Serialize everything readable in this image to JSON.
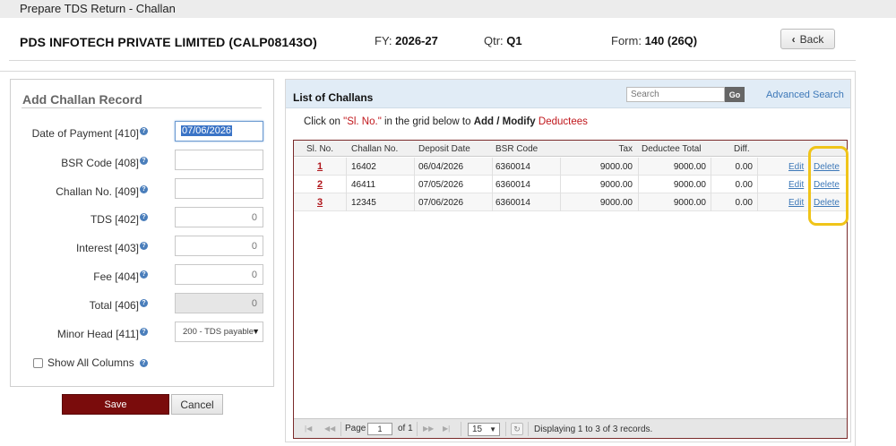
{
  "window": {
    "title": "Prepare TDS Return - Challan"
  },
  "header": {
    "company": "PDS INFOTECH PRIVATE LIMITED (CALP08143O)",
    "fy_label": "FY:",
    "fy_value": "2026-27",
    "qtr_label": "Qtr:",
    "qtr_value": "Q1",
    "form_label": "Form:",
    "form_value": "140 (26Q)",
    "back_label": "Back"
  },
  "left_panel": {
    "title": "Add Challan Record",
    "fields": [
      {
        "label": "Date of Payment [410]",
        "value": "07/06/2026"
      },
      {
        "label": "BSR Code [408]",
        "value": ""
      },
      {
        "label": "Challan No. [409]",
        "value": ""
      },
      {
        "label": "TDS [402]",
        "value": "0"
      },
      {
        "label": "Interest [403]",
        "value": "0"
      },
      {
        "label": "Fee [404]",
        "value": "0"
      },
      {
        "label": "Total [406]",
        "value": "0"
      },
      {
        "label": "Minor Head [411]",
        "value": "200 - TDS payable"
      }
    ],
    "show_all_columns": "Show All Columns",
    "save_label": "Save",
    "cancel_label": "Cancel"
  },
  "right_panel": {
    "title": "List of Challans",
    "search_placeholder": "Search",
    "go_label": "Go",
    "advanced_search": "Advanced Search",
    "instruction": {
      "part1": "Click on ",
      "part2": "\"Sl. No.\"",
      "part3": " in the grid below to ",
      "part4": "Add / Modify ",
      "part5": "Deductees"
    },
    "columns": [
      "Sl. No.",
      "Challan No.",
      "Deposit Date",
      "BSR Code",
      "Tax",
      "Deductee Total",
      "Diff."
    ],
    "rows": [
      {
        "sl": "1",
        "challan": "16402",
        "date": "06/04/2026",
        "bsr": "6360014",
        "tax": "9000.00",
        "deductee_total": "9000.00",
        "diff": "0.00",
        "edit": "Edit",
        "delete": "Delete"
      },
      {
        "sl": "2",
        "challan": "46411",
        "date": "07/05/2026",
        "bsr": "6360014",
        "tax": "9000.00",
        "deductee_total": "9000.00",
        "diff": "0.00",
        "edit": "Edit",
        "delete": "Delete"
      },
      {
        "sl": "3",
        "challan": "12345",
        "date": "07/06/2026",
        "bsr": "6360014",
        "tax": "9000.00",
        "deductee_total": "9000.00",
        "diff": "0.00",
        "edit": "Edit",
        "delete": "Delete"
      }
    ],
    "pager": {
      "page_label": "Page",
      "page_value": "1",
      "of_label": "of 1",
      "per_page": "15",
      "status": "Displaying 1 to 3 of 3 records."
    }
  },
  "colors": {
    "save_button": "#7a0c0c",
    "link": "#3d78b8",
    "sl_no": "#b0161c",
    "highlight": "#f0c419"
  }
}
